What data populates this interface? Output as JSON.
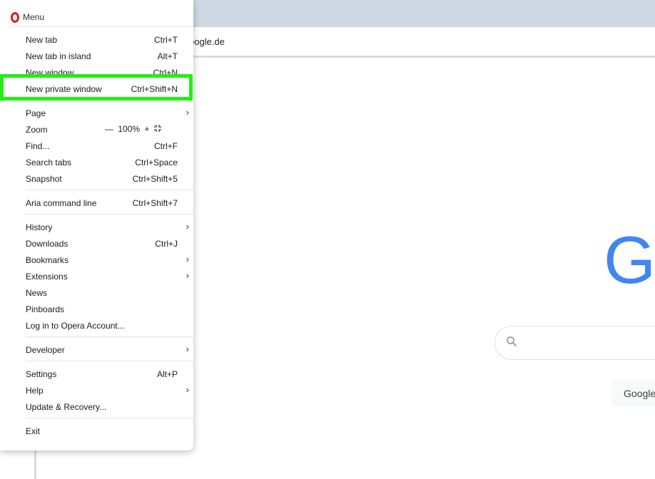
{
  "browser": {
    "address_text": "oogle.de"
  },
  "google": {
    "logo_letter": "G",
    "button_label": "Google",
    "brand_color": "#4285f4"
  },
  "menu": {
    "title": "Menu",
    "logo_icon": "opera-logo-icon",
    "items": [
      {
        "label": "New tab",
        "shortcut": "Ctrl+T"
      },
      {
        "label": "New tab in island",
        "shortcut": "Alt+T"
      },
      {
        "label": "New window",
        "shortcut": "Ctrl+N"
      },
      {
        "label": "New private window",
        "shortcut": "Ctrl+Shift+N"
      },
      {
        "label": "Page",
        "shortcut": ""
      },
      {
        "label": "Zoom",
        "shortcut": ""
      },
      {
        "label": "Find...",
        "shortcut": "Ctrl+F"
      },
      {
        "label": "Search tabs",
        "shortcut": "Ctrl+Space"
      },
      {
        "label": "Snapshot",
        "shortcut": "Ctrl+Shift+5"
      },
      {
        "label": "Aria command line",
        "shortcut": "Ctrl+Shift+7"
      },
      {
        "label": "History",
        "shortcut": ""
      },
      {
        "label": "Downloads",
        "shortcut": "Ctrl+J"
      },
      {
        "label": "Bookmarks",
        "shortcut": ""
      },
      {
        "label": "Extensions",
        "shortcut": ""
      },
      {
        "label": "News",
        "shortcut": ""
      },
      {
        "label": "Pinboards",
        "shortcut": ""
      },
      {
        "label": "Log in to Opera Account...",
        "shortcut": ""
      },
      {
        "label": "Developer",
        "shortcut": ""
      },
      {
        "label": "Settings",
        "shortcut": "Alt+P"
      },
      {
        "label": "Help",
        "shortcut": ""
      },
      {
        "label": "Update & Recovery...",
        "shortcut": ""
      },
      {
        "label": "Exit",
        "shortcut": ""
      }
    ],
    "zoom": {
      "minus": "—",
      "value": "100%",
      "plus": "+"
    },
    "highlight_color": "#23ee12"
  }
}
